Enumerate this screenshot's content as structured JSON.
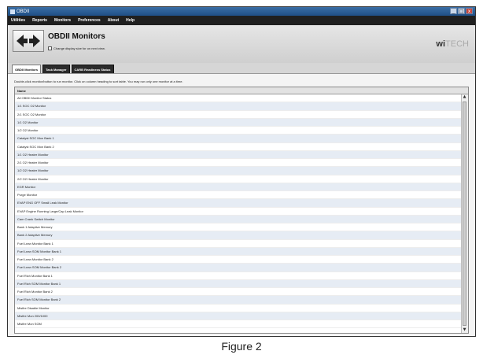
{
  "window": {
    "title": "OBDII",
    "controls": [
      "_",
      "□",
      "x"
    ]
  },
  "menu": [
    "Utilities",
    "Reports",
    "Monitors",
    "Preferences",
    "About",
    "Help"
  ],
  "header": {
    "title": "OBDII Monitors",
    "checkbox_label": "Change display size for on next view.",
    "logo_main": "wi",
    "logo_accent": "TECH"
  },
  "tabs": [
    "OBDII Monitors",
    "Task Manager",
    "CARB Readiness Status"
  ],
  "content": {
    "instruction": "Double-click monitor/button to run monitor.  Click on column heading to sort table.  You may run only one monitor at a time.",
    "column_header": "Name",
    "rows": [
      "All OBDII Monitor Status",
      "1/1 SOC O2 Monitor",
      "2/1 SOC O2 Monitor",
      "1/1 O2 Monitor",
      "1/2 O2 Monitor",
      "Catalyst SOC Mon Bank 1",
      "Catalyst SOC Mon Bank 2",
      "1/1 O2 Heater Monitor",
      "2/1 O2 Heater Monitor",
      "1/2 O2 Heater Monitor",
      "2/2 O2 Heater Monitor",
      "EGR Monitor",
      "Purge Monitor",
      "EVAP ENG OFF Small Leak Monitor",
      "EVAP Engine Running Large/Cap Leak Monitor",
      "Cam Crank Switch Monitor",
      "Bank 1 Adaptive Memory",
      "Bank 2 Adaptive Memory",
      "Fuel Lean Monitor Bank 1",
      "Fuel Lean SOM Monitor Bank 1",
      "Fuel Lean Monitor Bank 2",
      "Fuel Lean SOM Monitor Bank 2",
      "Fuel Rich Monitor Bank 1",
      "Fuel Rich SOM Monitor Bank 1",
      "Fuel Rich Monitor Bank 2",
      "Fuel Rich SOM Monitor Bank 2",
      "Misfire Disable Monitor",
      "Misfire Mon 200/1000",
      "Misfire Mon SOM"
    ]
  },
  "caption": "Figure 2",
  "colors": {
    "menubar": "#1f1f1f",
    "titlebar": "#1f4f86",
    "row_alt": "#e6ecf4"
  }
}
